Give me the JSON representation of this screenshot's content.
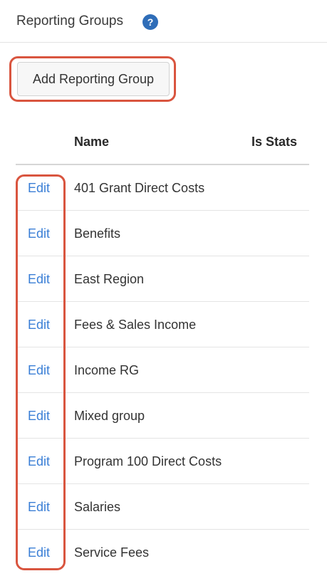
{
  "header": {
    "title": "Reporting Groups",
    "help_icon": "question-circle-icon",
    "help_glyph": "?"
  },
  "toolbar": {
    "add_label": "Add Reporting Group"
  },
  "table": {
    "columns": [
      "Name",
      "Is Stats"
    ],
    "rows": [
      {
        "action": "Edit",
        "name": "401 Grant Direct Costs",
        "is_stats": ""
      },
      {
        "action": "Edit",
        "name": "Benefits",
        "is_stats": ""
      },
      {
        "action": "Edit",
        "name": "East Region",
        "is_stats": ""
      },
      {
        "action": "Edit",
        "name": "Fees & Sales Income",
        "is_stats": ""
      },
      {
        "action": "Edit",
        "name": "Income RG",
        "is_stats": ""
      },
      {
        "action": "Edit",
        "name": "Mixed group",
        "is_stats": ""
      },
      {
        "action": "Edit",
        "name": "Program 100 Direct Costs",
        "is_stats": ""
      },
      {
        "action": "Edit",
        "name": "Salaries",
        "is_stats": ""
      },
      {
        "action": "Edit",
        "name": "Service Fees",
        "is_stats": ""
      }
    ]
  },
  "colors": {
    "highlight": "#d9553f",
    "link": "#3b7fd6",
    "help_icon_bg": "#2f6db8"
  }
}
